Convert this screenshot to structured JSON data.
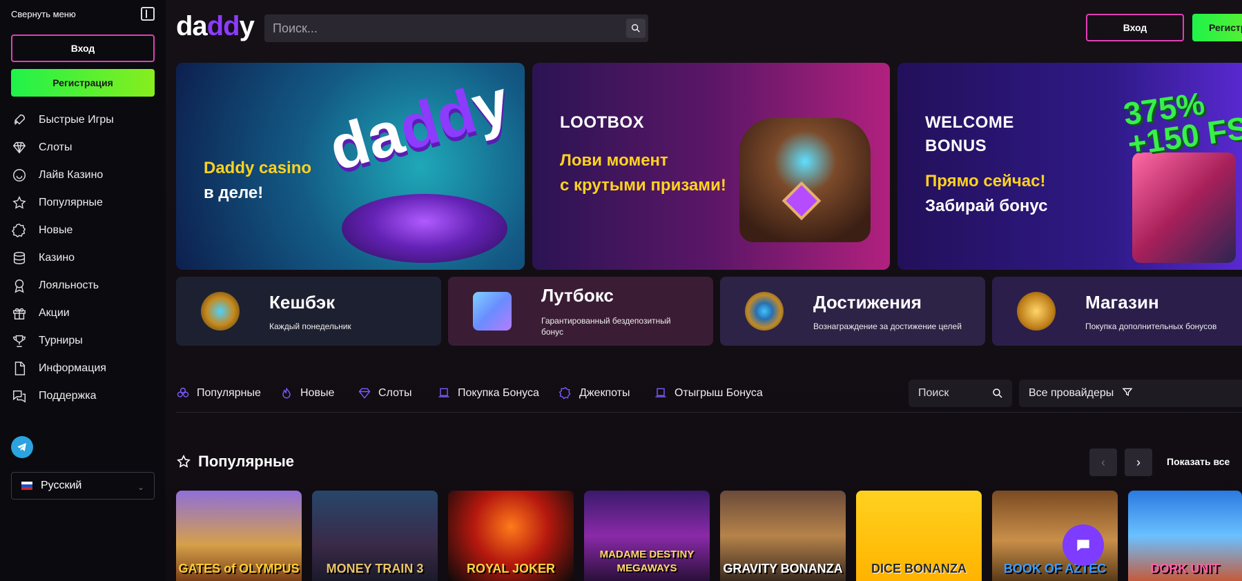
{
  "sidebar": {
    "collapse_label": "Свернуть меню",
    "login_label": "Вход",
    "register_label": "Регистрация",
    "items": [
      {
        "label": "Быстрые Игры",
        "icon": "rocket-icon"
      },
      {
        "label": "Слоты",
        "icon": "diamond-icon"
      },
      {
        "label": "Лайв Казино",
        "icon": "live-casino-icon"
      },
      {
        "label": "Популярные",
        "icon": "star-icon"
      },
      {
        "label": "Новые",
        "icon": "new-badge-icon"
      },
      {
        "label": "Казино",
        "icon": "coins-icon"
      },
      {
        "label": "Лояльность",
        "icon": "medal-icon"
      },
      {
        "label": "Акции",
        "icon": "gift-icon"
      },
      {
        "label": "Турниры",
        "icon": "trophy-icon"
      },
      {
        "label": "Информация",
        "icon": "document-icon"
      },
      {
        "label": "Поддержка",
        "icon": "chat-icon"
      }
    ],
    "language": "Русский"
  },
  "header": {
    "logo_prefix": "da",
    "logo_highlight": "dd",
    "logo_suffix": "y",
    "search_placeholder": "Поиск...",
    "login_label": "Вход",
    "register_label": "Регистрация"
  },
  "banners": [
    {
      "line1": "Daddy casino",
      "line2": "в деле!"
    },
    {
      "title": "LOOTBOX",
      "line1": "Лови момент",
      "line2": "с крутыми призами!"
    },
    {
      "title_line1": "WELCOME",
      "title_line2": "BONUS",
      "line1": "Прямо сейчас!",
      "line2": "Забирай бонус",
      "bonus_line1": "375%",
      "bonus_line2": "+150 FS"
    }
  ],
  "features": [
    {
      "title": "Кешбэк",
      "desc": "Каждый понедельник"
    },
    {
      "title": "Лутбокс",
      "desc": "Гарантированный бездепозитный бонус"
    },
    {
      "title": "Достижения",
      "desc": "Вознаграждение за достижение целей"
    },
    {
      "title": "Магазин",
      "desc": "Покупка дополнительных бонусов"
    }
  ],
  "categories": [
    {
      "label": "Популярные"
    },
    {
      "label": "Новые"
    },
    {
      "label": "Слоты"
    },
    {
      "label": "Покупка Бонуса"
    },
    {
      "label": "Джекпоты"
    },
    {
      "label": "Отыгрыш Бонуса"
    }
  ],
  "filters": {
    "search_label": "Поиск",
    "providers_label": "Все провайдеры"
  },
  "section": {
    "title": "Популярные",
    "show_all": "Показать все"
  },
  "games": [
    {
      "title": "GATES of OLYMPUS"
    },
    {
      "title": "MONEY TRAIN 3"
    },
    {
      "title": "ROYAL JOKER"
    },
    {
      "title": "MADAME DESTINY MEGAWAYS"
    },
    {
      "title": "GRAVITY BONANZA"
    },
    {
      "title": "DICE BONANZA"
    },
    {
      "title": "BOOK OF AZTEC"
    },
    {
      "title": "DORK UNIT"
    }
  ],
  "colors": {
    "accent_pink": "#e23fb7",
    "accent_green": "#1ff24a",
    "accent_purple": "#8c3bff",
    "banner_yellow": "#ffd21f"
  }
}
